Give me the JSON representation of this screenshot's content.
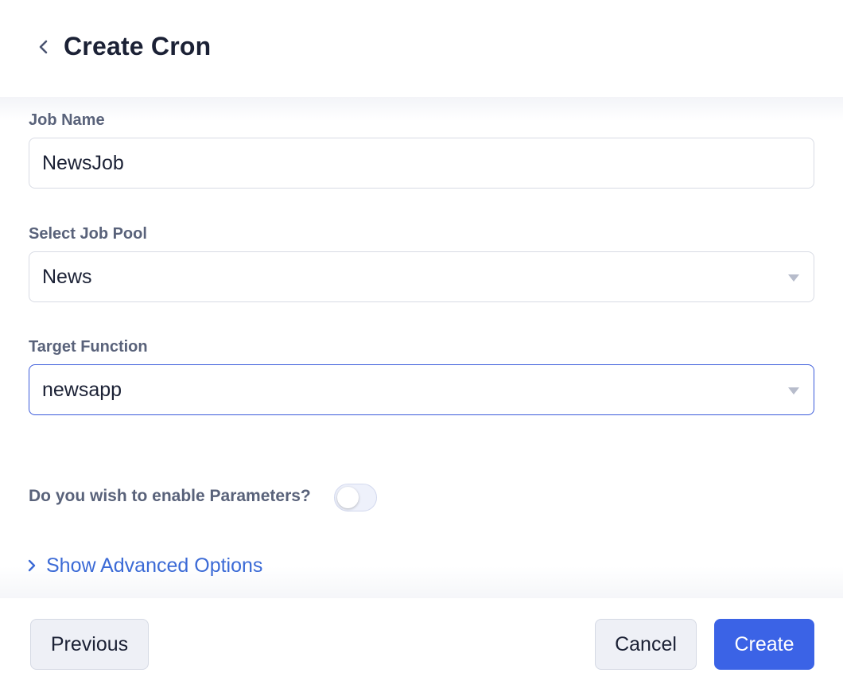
{
  "header": {
    "title": "Create Cron",
    "back_icon": "chevron-left-icon"
  },
  "form": {
    "job_name": {
      "label": "Job Name",
      "value": "NewsJob"
    },
    "job_pool": {
      "label": "Select Job Pool",
      "value": "News"
    },
    "target_function": {
      "label": "Target Function",
      "value": "newsapp"
    },
    "parameters": {
      "label": "Do you wish to enable Parameters?",
      "enabled": false
    },
    "advanced": {
      "label": "Show Advanced Options",
      "expand_icon": "chevron-right-icon"
    }
  },
  "footer": {
    "previous_label": "Previous",
    "cancel_label": "Cancel",
    "create_label": "Create"
  },
  "colors": {
    "primary": "#3b63e6",
    "link": "#3b6ad6",
    "focus_border": "#3b5bdb",
    "title_text": "#1b2135",
    "label_text": "#59627a"
  }
}
